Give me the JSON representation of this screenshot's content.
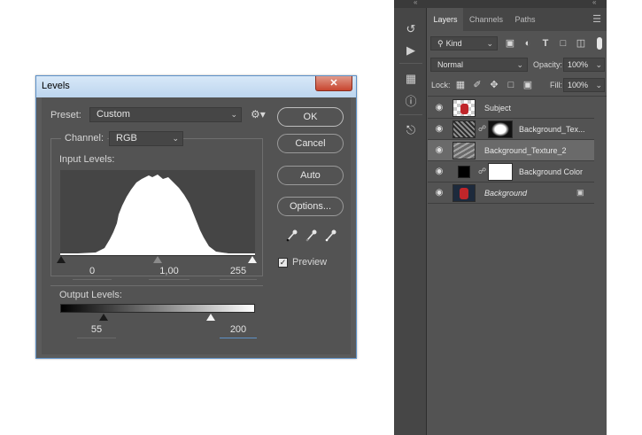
{
  "levels": {
    "title": "Levels",
    "close_glyph": "✕",
    "preset": {
      "label": "Preset:",
      "value": "Custom"
    },
    "channel": {
      "label": "Channel:",
      "value": "RGB"
    },
    "input_levels": {
      "label": "Input Levels:",
      "black": "0",
      "gamma": "1,00",
      "white": "255"
    },
    "output_levels": {
      "label": "Output Levels:",
      "black": "55",
      "white": "200"
    },
    "buttons": {
      "ok": "OK",
      "cancel": "Cancel",
      "auto": "Auto",
      "options": "Options..."
    },
    "preview": {
      "label": "Preview",
      "checked": true
    }
  },
  "layers_panel": {
    "tabs": [
      {
        "label": "Layers",
        "active": true
      },
      {
        "label": "Channels",
        "active": false
      },
      {
        "label": "Paths",
        "active": false
      }
    ],
    "filter": {
      "value": "Kind"
    },
    "blend_mode": "Normal",
    "opacity": {
      "label": "Opacity:",
      "value": "100%"
    },
    "lock": {
      "label": "Lock:"
    },
    "fill": {
      "label": "Fill:",
      "value": "100%"
    },
    "layers": [
      {
        "name": "Subject",
        "visible": true,
        "selected": false,
        "has_mask": false
      },
      {
        "name": "Background_Tex...",
        "visible": true,
        "selected": false,
        "has_mask": true
      },
      {
        "name": "Background_Texture_2",
        "visible": true,
        "selected": true,
        "has_mask": false
      },
      {
        "name": "Background Color",
        "visible": true,
        "selected": false,
        "has_mask": true
      },
      {
        "name": "Background",
        "visible": true,
        "selected": false,
        "has_mask": false,
        "locked": true
      }
    ]
  },
  "colors": {
    "dialog_bg": "#535353",
    "dialog_border": "#5e91c7",
    "panel_bg": "#535353",
    "selected_layer": "#6a6a6a"
  }
}
